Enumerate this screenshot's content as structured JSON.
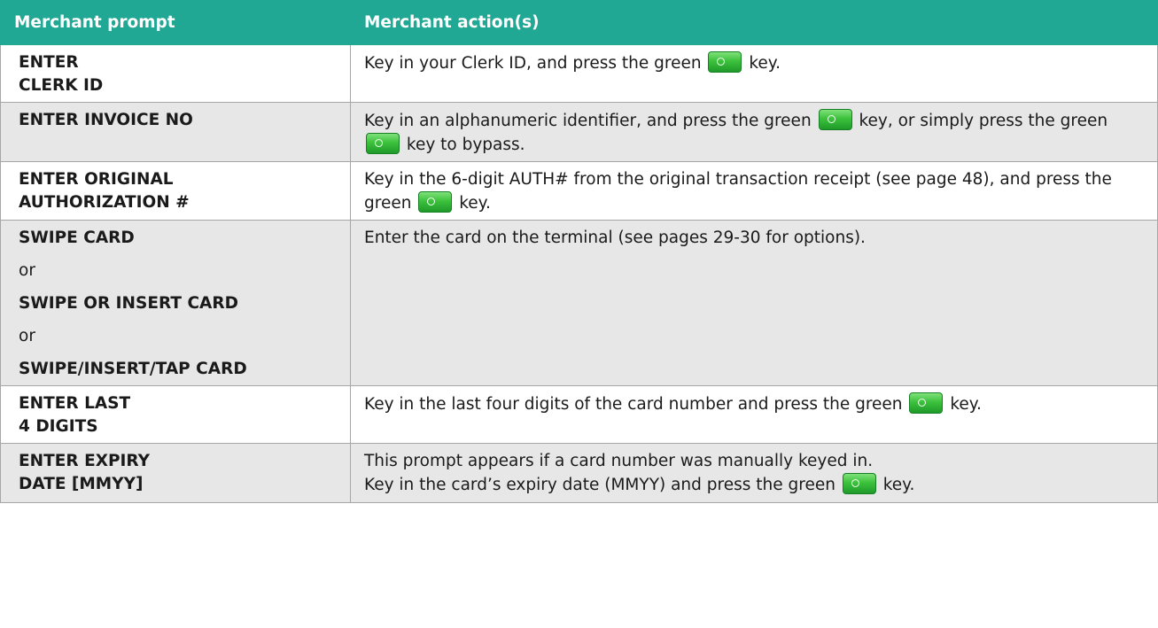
{
  "header": {
    "col1": "Merchant prompt",
    "col2": "Merchant action(s)"
  },
  "rows": [
    {
      "prompt": [
        "ENTER",
        "CLERK ID"
      ],
      "action": {
        "t1": "Key in your Clerk ID, and press the green",
        "t2": "key."
      }
    },
    {
      "prompt": [
        "ENTER INVOICE NO"
      ],
      "action": {
        "t1": "Key in an alphanumeric identifier, and press the green",
        "t2": "key, or simply press the green",
        "t3": "key to bypass."
      }
    },
    {
      "prompt": [
        "ENTER ORIGINAL",
        "AUTHORIZATION #"
      ],
      "action": {
        "t1": "Key in the 6-digit AUTH# from the original transaction receipt (see page 48), and press the green",
        "t2": "key."
      }
    },
    {
      "prompt": [
        "SWIPE CARD",
        "or",
        "SWIPE OR INSERT CARD",
        "or",
        "SWIPE/INSERT/TAP CARD"
      ],
      "action": {
        "t1": "Enter the card on the terminal (see pages 29-30 for options)."
      }
    },
    {
      "prompt": [
        "ENTER LAST",
        "4 DIGITS"
      ],
      "action": {
        "t1": "Key in the last four digits of the card number and press the green",
        "t2": "key."
      }
    },
    {
      "prompt": [
        "ENTER EXPIRY",
        "DATE [MMYY]"
      ],
      "action": {
        "line1": "This prompt appears if a card number was manually keyed in.",
        "t1": "Key in the card’s expiry date (MMYY) and press the green",
        "t2": "key."
      }
    }
  ],
  "icons": {
    "green_key": "green-enter-key-icon",
    "green_key_color": "#3cc23c",
    "header_color": "#20a894",
    "alt_row_color": "#e7e7e7"
  }
}
